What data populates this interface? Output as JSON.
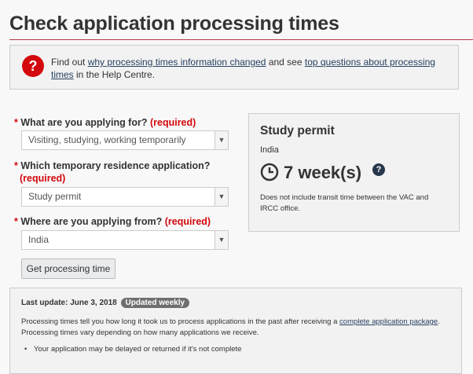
{
  "page": {
    "title": "Check application processing times"
  },
  "info": {
    "prefix": "Find out ",
    "link1": "why processing times information changed",
    "middle": " and see ",
    "link2": "top questions about processing times",
    "suffix": " in the Help Centre."
  },
  "form": {
    "star": "*",
    "required": "(required)",
    "q1": {
      "label": "What are you applying for?",
      "value": "Visiting, studying, working temporarily"
    },
    "q2": {
      "label": "Which temporary residence application?",
      "value": "Study permit"
    },
    "q3": {
      "label": "Where are you applying from?",
      "value": "India"
    },
    "submit": "Get processing time"
  },
  "result": {
    "title": "Study permit",
    "country": "India",
    "time": "7 week(s)",
    "note": "Does not include transit time between the VAC and IRCC office."
  },
  "update": {
    "label": "Last update: June 3, 2018",
    "badge": "Updated weekly",
    "p_prefix": "Processing times tell you how long it took us to process applications in the past after receiving a ",
    "p_link": "complete application package",
    "p_suffix": ". Processing times vary depending on how many applications we receive.",
    "bullet1": "Your application may be delayed or returned if it's not complete"
  },
  "colors": {
    "accent_red": "#d3080c",
    "rule": "#af3c43",
    "link": "#284162"
  }
}
